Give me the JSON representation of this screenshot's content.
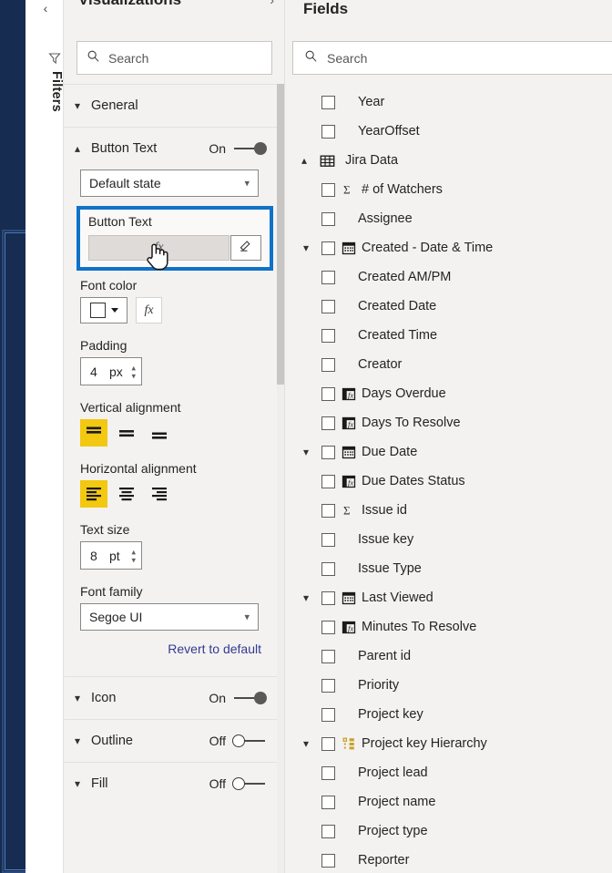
{
  "canvas": {
    "selection_color": "#4f7bb5",
    "background": "#172c51"
  },
  "filters_tab": {
    "label": "Filters",
    "collapse_icon": "chevron-left-icon",
    "funnel_icon": "filter-funnel-icon"
  },
  "visualizations": {
    "title": "Visualizations",
    "expand_icon": "chevron-right-icon",
    "search": {
      "placeholder": "Search",
      "value": "",
      "icon": "search-icon"
    },
    "sections": [
      {
        "name": "General",
        "chevron": "chevron-down-icon",
        "expanded": false,
        "toggle": null
      },
      {
        "name": "Button Text",
        "chevron": "chevron-up-icon",
        "expanded": true,
        "toggle": "On"
      },
      {
        "name": "Icon",
        "chevron": "chevron-down-icon",
        "expanded": false,
        "toggle": "On"
      },
      {
        "name": "Outline",
        "chevron": "chevron-down-icon",
        "expanded": false,
        "toggle": "Off"
      },
      {
        "name": "Fill",
        "chevron": "chevron-down-icon",
        "expanded": false,
        "toggle": "Off"
      }
    ],
    "button_text_section": {
      "state_dropdown": {
        "value": "Default state",
        "chevron": "chevron-down-icon"
      },
      "highlight": {
        "label": "Button Text",
        "input_value": "",
        "fx_glyph": "fx",
        "eraser_icon": "eraser-icon",
        "border_color": "#0f71c8",
        "cursor_icon": "hand-pointer-cursor"
      },
      "font_color": {
        "label": "Font color",
        "swatch_color": "#ffffff",
        "dropdown_icon": "caret-down-icon",
        "fx_label": "fx"
      },
      "padding": {
        "label": "Padding",
        "value": "4",
        "unit": "px",
        "spinner_icon": "spinner-arrows-icon"
      },
      "vertical_alignment": {
        "label": "Vertical alignment",
        "options": [
          "align-top-icon",
          "align-middle-icon",
          "align-bottom-icon"
        ],
        "selected_index": 0,
        "selected_color": "#f2c811"
      },
      "horizontal_alignment": {
        "label": "Horizontal alignment",
        "options": [
          "align-left-icon",
          "align-center-icon",
          "align-right-icon"
        ],
        "selected_index": 0,
        "selected_color": "#f2c811"
      },
      "text_size": {
        "label": "Text size",
        "value": "8",
        "unit": "pt",
        "spinner_icon": "spinner-arrows-icon"
      },
      "font_family": {
        "label": "Font family",
        "value": "Segoe UI",
        "chevron": "chevron-down-icon"
      },
      "revert": "Revert to default"
    }
  },
  "fields": {
    "title": "Fields",
    "search": {
      "placeholder": "Search",
      "value": "",
      "icon": "search-icon"
    },
    "items": [
      {
        "label": "Year",
        "icon": null,
        "chevron": null,
        "indent": 0
      },
      {
        "label": "YearOffset",
        "icon": null,
        "chevron": null,
        "indent": 0
      },
      {
        "label": "Jira Data",
        "icon": "table-icon",
        "chevron": "chevron-up-icon",
        "indent": -1,
        "is_table": true
      },
      {
        "label": "# of Watchers",
        "icon": "sigma-icon",
        "chevron": null,
        "indent": 1
      },
      {
        "label": "Assignee",
        "icon": null,
        "chevron": null,
        "indent": 1
      },
      {
        "label": "Created - Date & Time",
        "icon": "calendar-icon",
        "chevron": "chevron-down-icon",
        "indent": 1
      },
      {
        "label": "Created AM/PM",
        "icon": null,
        "chevron": null,
        "indent": 1
      },
      {
        "label": "Created Date",
        "icon": null,
        "chevron": null,
        "indent": 1
      },
      {
        "label": "Created Time",
        "icon": null,
        "chevron": null,
        "indent": 1
      },
      {
        "label": "Creator",
        "icon": null,
        "chevron": null,
        "indent": 1
      },
      {
        "label": "Days Overdue",
        "icon": "calculated-column-icon",
        "chevron": null,
        "indent": 1
      },
      {
        "label": "Days To Resolve",
        "icon": "calculated-column-icon",
        "chevron": null,
        "indent": 1
      },
      {
        "label": "Due Date",
        "icon": "calendar-icon",
        "chevron": "chevron-down-icon",
        "indent": 1
      },
      {
        "label": "Due Dates Status",
        "icon": "calculated-column-icon",
        "chevron": null,
        "indent": 1
      },
      {
        "label": "Issue id",
        "icon": "sigma-icon",
        "chevron": null,
        "indent": 1
      },
      {
        "label": "Issue key",
        "icon": null,
        "chevron": null,
        "indent": 1
      },
      {
        "label": "Issue Type",
        "icon": null,
        "chevron": null,
        "indent": 1
      },
      {
        "label": "Last Viewed",
        "icon": "calendar-icon",
        "chevron": "chevron-down-icon",
        "indent": 1
      },
      {
        "label": "Minutes To Resolve",
        "icon": "calculated-column-icon",
        "chevron": null,
        "indent": 1
      },
      {
        "label": "Parent id",
        "icon": null,
        "chevron": null,
        "indent": 1
      },
      {
        "label": "Priority",
        "icon": null,
        "chevron": null,
        "indent": 1
      },
      {
        "label": "Project key",
        "icon": null,
        "chevron": null,
        "indent": 1
      },
      {
        "label": "Project key Hierarchy",
        "icon": "hierarchy-icon",
        "chevron": "chevron-down-icon",
        "indent": 1
      },
      {
        "label": "Project lead",
        "icon": null,
        "chevron": null,
        "indent": 1
      },
      {
        "label": "Project name",
        "icon": null,
        "chevron": null,
        "indent": 1
      },
      {
        "label": "Project type",
        "icon": null,
        "chevron": null,
        "indent": 1
      },
      {
        "label": "Reporter",
        "icon": null,
        "chevron": null,
        "indent": 1
      }
    ]
  }
}
